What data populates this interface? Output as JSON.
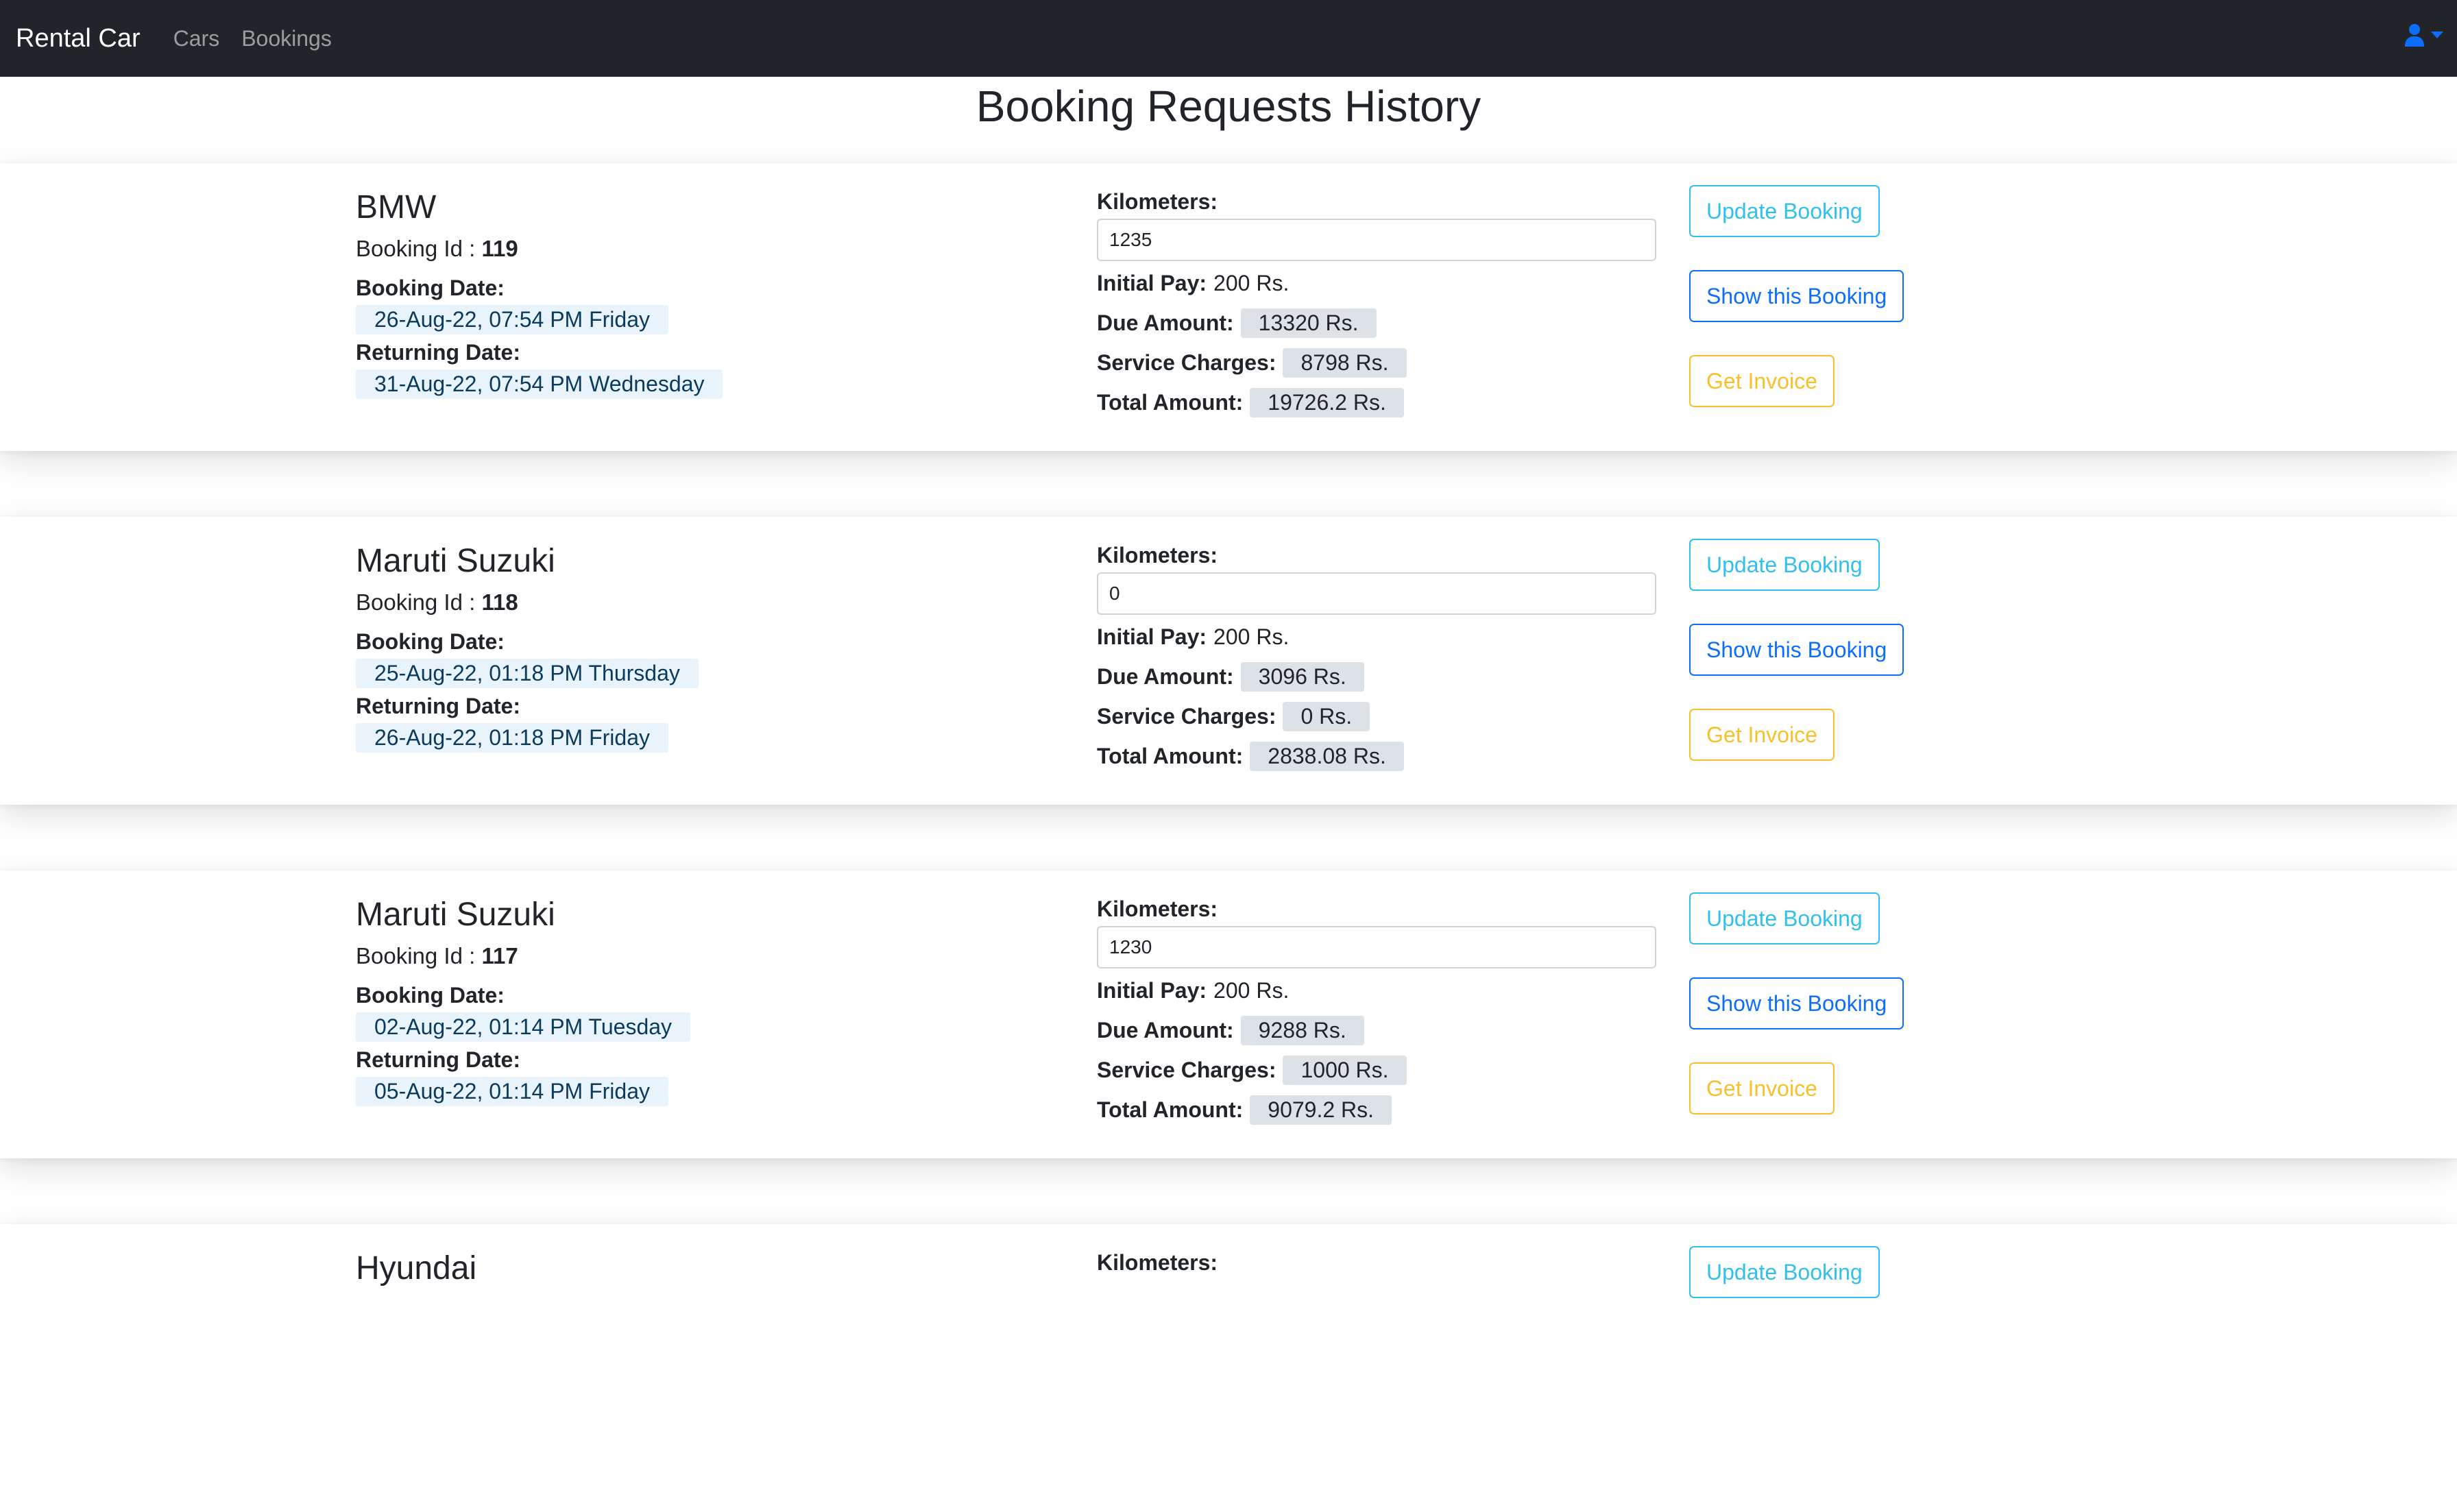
{
  "navbar": {
    "brand": "Rental Car",
    "links": [
      "Cars",
      "Bookings"
    ],
    "accent_color": "#0d6efd",
    "user_icon": "user-icon"
  },
  "page": {
    "title": "Booking Requests History"
  },
  "labels": {
    "booking_id": "Booking Id :",
    "booking_date": "Booking Date:",
    "returning_date": "Returning Date:",
    "kilometers": "Kilometers:",
    "initial_pay": "Initial Pay:",
    "due_amount": "Due Amount:",
    "service_charges": "Service Charges:",
    "total_amount": "Total Amount:",
    "update_button": "Update Booking",
    "show_button": "Show this Booking",
    "invoice_button": "Get Invoice"
  },
  "bookings": [
    {
      "car": "BMW",
      "id": "119",
      "booking_date": "26-Aug-22, 07:54 PM Friday",
      "returning_date": "31-Aug-22, 07:54 PM Wednesday",
      "kilometers": "1235",
      "initial_pay": "200 Rs.",
      "due_amount": "13320 Rs.",
      "service_charges": "8798 Rs.",
      "total_amount": "19726.2 Rs."
    },
    {
      "car": "Maruti Suzuki",
      "id": "118",
      "booking_date": "25-Aug-22, 01:18 PM Thursday",
      "returning_date": "26-Aug-22, 01:18 PM Friday",
      "kilometers": "0",
      "initial_pay": "200 Rs.",
      "due_amount": "3096 Rs.",
      "service_charges": "0 Rs.",
      "total_amount": "2838.08 Rs."
    },
    {
      "car": "Maruti Suzuki",
      "id": "117",
      "booking_date": "02-Aug-22, 01:14 PM Tuesday",
      "returning_date": "05-Aug-22, 01:14 PM Friday",
      "kilometers": "1230",
      "initial_pay": "200 Rs.",
      "due_amount": "9288 Rs.",
      "service_charges": "1000 Rs.",
      "total_amount": "9079.2 Rs."
    },
    {
      "car": "Hyundai",
      "kilometers_label": "Kilometers:"
    }
  ]
}
